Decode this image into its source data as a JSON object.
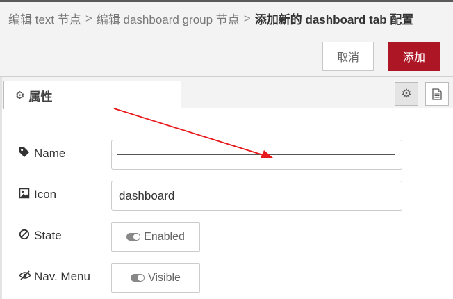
{
  "breadcrumb": {
    "item1": "编辑 text 节点",
    "item2": "编辑 dashboard group 节点",
    "current": "添加新的 dashboard tab 配置",
    "separator": ">"
  },
  "toolbar": {
    "cancel_label": "取消",
    "add_label": "添加"
  },
  "tabs": {
    "properties_label": "属性"
  },
  "form": {
    "name": {
      "label": "Name",
      "value": ""
    },
    "icon": {
      "label": "Icon",
      "value": "dashboard"
    },
    "state": {
      "label": "State",
      "toggle_label": "Enabled"
    },
    "nav_menu": {
      "label": "Nav. Menu",
      "toggle_label": "Visible"
    }
  },
  "colors": {
    "accent": "#ad1625",
    "annotation_arrow": "#e8191c"
  },
  "icons": {
    "tab": "gear-icon",
    "settings": "gear-icon",
    "description": "document-icon",
    "name": "tag-icon",
    "icon": "image-icon",
    "state": "ban-icon",
    "nav_menu": "eye-slash-icon"
  }
}
